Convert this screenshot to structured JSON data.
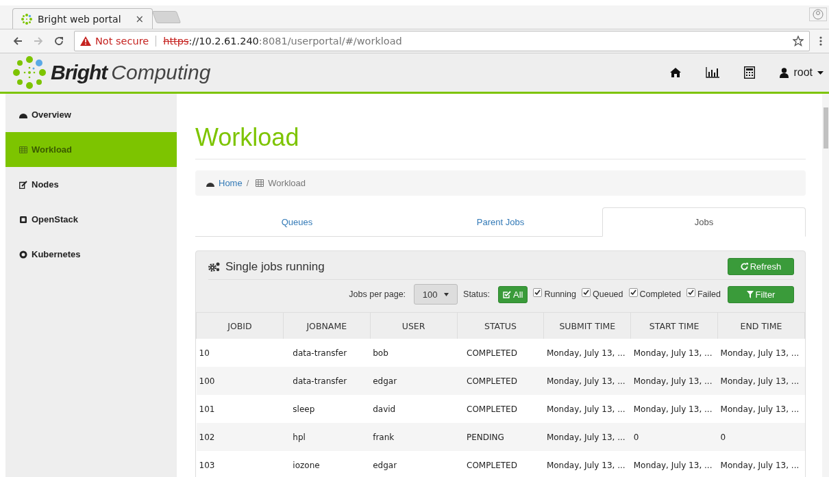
{
  "browser": {
    "tab_title": "Bright web portal",
    "tab_close": "×",
    "security": "Not secure",
    "url_scheme": "https",
    "url_host": "://10.2.61.240",
    "url_rest": ":8081/userportal/#/workload"
  },
  "header": {
    "logo_bold": "Bright",
    "logo_light": "Computing",
    "user": "root"
  },
  "sidebar": {
    "items": [
      {
        "label": "Overview",
        "kind": "dashboard",
        "selected": false
      },
      {
        "label": "Workload",
        "kind": "table",
        "selected": true
      },
      {
        "label": "Nodes",
        "kind": "edit",
        "selected": false
      },
      {
        "label": "OpenStack",
        "kind": "square",
        "selected": false
      },
      {
        "label": "Kubernetes",
        "kind": "wheel",
        "selected": false
      }
    ]
  },
  "page_title": "Workload",
  "breadcrumb": {
    "home": "Home",
    "separator": "/",
    "current": "Workload"
  },
  "tabs": [
    {
      "label": "Queues",
      "selected": false
    },
    {
      "label": "Parent Jobs",
      "selected": false
    },
    {
      "label": "Jobs",
      "selected": true
    }
  ],
  "panel": {
    "title": "Single jobs running",
    "refresh": "Refresh",
    "jobs_per_page_label": "Jobs per page:",
    "jobs_per_page": "100",
    "status_label": "Status:",
    "all": "All",
    "filter": "Filter",
    "statuses": [
      {
        "label": "Running",
        "checked": true
      },
      {
        "label": "Queued",
        "checked": true
      },
      {
        "label": "Completed",
        "checked": true
      },
      {
        "label": "Failed",
        "checked": true
      }
    ]
  },
  "table": {
    "columns": [
      "JOBID",
      "JOBNAME",
      "USER",
      "STATUS",
      "SUBMIT TIME",
      "START TIME",
      "END TIME"
    ],
    "rows": [
      [
        "10",
        "data-transfer",
        "bob",
        "COMPLETED",
        "Monday, July 13, ...",
        "Monday, July 13, ...",
        "Monday, July 13, ..."
      ],
      [
        "100",
        "data-transfer",
        "edgar",
        "COMPLETED",
        "Monday, July 13, ...",
        "Monday, July 13, ...",
        "Monday, July 13, ..."
      ],
      [
        "101",
        "sleep",
        "david",
        "COMPLETED",
        "Monday, July 13, ...",
        "Monday, July 13, ...",
        "Monday, July 13, ..."
      ],
      [
        "102",
        "hpl",
        "frank",
        "PENDING",
        "Monday, July 13, ...",
        "0",
        "0"
      ],
      [
        "103",
        "iozone",
        "edgar",
        "COMPLETED",
        "Monday, July 13, ...",
        "Monday, July 13, ...",
        "Monday, July 13, ..."
      ]
    ]
  }
}
